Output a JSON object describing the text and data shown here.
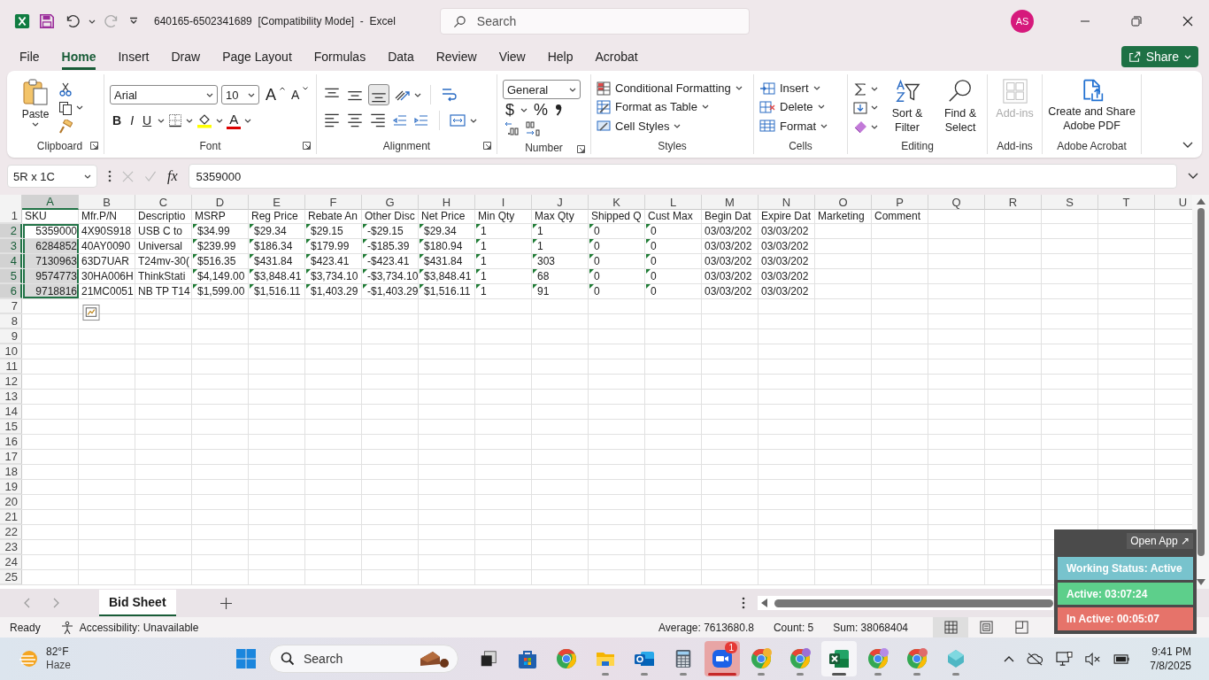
{
  "title_bar": {
    "title": "640165-6502341689  [Compatibility Mode]  -  Excel",
    "search": {
      "placeholder": "Search"
    },
    "avatar": "AS"
  },
  "menu": {
    "tabs": [
      {
        "label": "File",
        "selected": false
      },
      {
        "label": "Home",
        "selected": true
      },
      {
        "label": "Insert",
        "selected": false
      },
      {
        "label": "Draw",
        "selected": false
      },
      {
        "label": "Page Layout",
        "selected": false
      },
      {
        "label": "Formulas",
        "selected": false
      },
      {
        "label": "Data",
        "selected": false
      },
      {
        "label": "Review",
        "selected": false
      },
      {
        "label": "View",
        "selected": false
      },
      {
        "label": "Help",
        "selected": false
      },
      {
        "label": "Acrobat",
        "selected": false
      }
    ],
    "share": "Share"
  },
  "ribbon": {
    "clipboard": {
      "label": "Clipboard",
      "paste": "Paste"
    },
    "font": {
      "label": "Font",
      "family": "Arial",
      "size": "10",
      "grow": "A",
      "shrink": "A",
      "bold": "B",
      "italic": "I",
      "underline": "U",
      "color_button": "A"
    },
    "alignment": {
      "label": "Alignment",
      "vertical_align": [
        {
          "kind": "top",
          "selected": false
        },
        {
          "kind": "middle",
          "selected": false
        },
        {
          "kind": "bottom",
          "selected": true
        }
      ]
    },
    "number": {
      "label": "Number",
      "format": "General",
      "currency": "$",
      "percent": "%"
    },
    "styles": {
      "label": "Styles",
      "items": [
        {
          "label": "Conditional Formatting",
          "kind": "conditional"
        },
        {
          "label": "Format as Table",
          "kind": "table"
        },
        {
          "label": "Cell Styles",
          "kind": "styles"
        }
      ]
    },
    "cells": {
      "label": "Cells",
      "items": [
        {
          "label": "Insert",
          "kind": "insert"
        },
        {
          "label": "Delete",
          "kind": "delete"
        },
        {
          "label": "Format",
          "kind": "format"
        }
      ]
    },
    "editing": {
      "label": "Editing",
      "sort": "Sort & Filter",
      "find": "Find & Select"
    },
    "addins": {
      "label": "Add-ins",
      "button": "Add-ins",
      "disabled": true
    },
    "acrobat": {
      "label": "Adobe Acrobat",
      "button": "Create and Share Adobe PDF"
    }
  },
  "formula_bar": {
    "name_box": "5R x 1C",
    "fx": "fx",
    "formula": "5359000"
  },
  "grid": {
    "columns": [
      {
        "label": "A",
        "selected": true
      },
      {
        "label": "B",
        "selected": false
      },
      {
        "label": "C",
        "selected": false
      },
      {
        "label": "D",
        "selected": false
      },
      {
        "label": "E",
        "selected": false
      },
      {
        "label": "F",
        "selected": false
      },
      {
        "label": "G",
        "selected": false
      },
      {
        "label": "H",
        "selected": false
      },
      {
        "label": "I",
        "selected": false
      },
      {
        "label": "J",
        "selected": false
      },
      {
        "label": "K",
        "selected": false
      },
      {
        "label": "L",
        "selected": false
      },
      {
        "label": "M",
        "selected": false
      },
      {
        "label": "N",
        "selected": false
      },
      {
        "label": "O",
        "selected": false
      },
      {
        "label": "P",
        "selected": false
      },
      {
        "label": "Q",
        "selected": false
      },
      {
        "label": "R",
        "selected": false
      },
      {
        "label": "S",
        "selected": false
      },
      {
        "label": "T",
        "selected": false
      },
      {
        "label": "U",
        "selected": false
      }
    ],
    "rows": [
      {
        "number": "1",
        "selected": false,
        "cells": [
          {
            "text": "SKU",
            "kind": "text",
            "flag": false
          },
          {
            "text": "Mfr.P/N",
            "kind": "text",
            "flag": false
          },
          {
            "text": "Descriptio",
            "kind": "text",
            "flag": false
          },
          {
            "text": "MSRP",
            "kind": "text",
            "flag": false
          },
          {
            "text": "Reg Price",
            "kind": "text",
            "flag": false
          },
          {
            "text": "Rebate An",
            "kind": "text",
            "flag": false
          },
          {
            "text": "Other Disc",
            "kind": "text",
            "flag": false
          },
          {
            "text": "Net Price",
            "kind": "text",
            "flag": false
          },
          {
            "text": "Min Qty",
            "kind": "text",
            "flag": false
          },
          {
            "text": "Max Qty",
            "kind": "text",
            "flag": false
          },
          {
            "text": "Shipped Q",
            "kind": "text",
            "flag": false
          },
          {
            "text": "Cust Max",
            "kind": "text",
            "flag": false
          },
          {
            "text": "Begin Dat",
            "kind": "text",
            "flag": false
          },
          {
            "text": "Expire Dat",
            "kind": "text",
            "flag": false
          },
          {
            "text": "Marketing",
            "kind": "text",
            "flag": false
          },
          {
            "text": "Comment",
            "kind": "text",
            "flag": false
          }
        ]
      },
      {
        "number": "2",
        "selected": true,
        "cells": [
          {
            "text": "5359000",
            "kind": "number",
            "flag": false
          },
          {
            "text": "4X90S918",
            "kind": "text",
            "flag": false
          },
          {
            "text": "USB C to",
            "kind": "text",
            "flag": false
          },
          {
            "text": "$34.99",
            "kind": "text",
            "flag": true
          },
          {
            "text": "$29.34",
            "kind": "text",
            "flag": true
          },
          {
            "text": "$29.15",
            "kind": "text",
            "flag": true
          },
          {
            "text": "-$29.15",
            "kind": "text",
            "flag": true
          },
          {
            "text": "$29.34",
            "kind": "text",
            "flag": true
          },
          {
            "text": "1",
            "kind": "text",
            "flag": true
          },
          {
            "text": "1",
            "kind": "text",
            "flag": true
          },
          {
            "text": "0",
            "kind": "text",
            "flag": true
          },
          {
            "text": "0",
            "kind": "text",
            "flag": true
          },
          {
            "text": "03/03/202",
            "kind": "text",
            "flag": false
          },
          {
            "text": "03/03/202",
            "kind": "text",
            "flag": false
          }
        ]
      },
      {
        "number": "3",
        "selected": true,
        "cells": [
          {
            "text": "6284852",
            "kind": "number",
            "flag": false
          },
          {
            "text": "40AY0090",
            "kind": "text",
            "flag": false
          },
          {
            "text": "Universal",
            "kind": "text",
            "flag": false
          },
          {
            "text": "$239.99",
            "kind": "text",
            "flag": true
          },
          {
            "text": "$186.34",
            "kind": "text",
            "flag": true
          },
          {
            "text": "$179.99",
            "kind": "text",
            "flag": true
          },
          {
            "text": "-$185.39",
            "kind": "text",
            "flag": true
          },
          {
            "text": "$180.94",
            "kind": "text",
            "flag": true
          },
          {
            "text": "1",
            "kind": "text",
            "flag": true
          },
          {
            "text": "1",
            "kind": "text",
            "flag": true
          },
          {
            "text": "0",
            "kind": "text",
            "flag": true
          },
          {
            "text": "0",
            "kind": "text",
            "flag": true
          },
          {
            "text": "03/03/202",
            "kind": "text",
            "flag": false
          },
          {
            "text": "03/03/202",
            "kind": "text",
            "flag": false
          }
        ]
      },
      {
        "number": "4",
        "selected": true,
        "cells": [
          {
            "text": "7130963",
            "kind": "number",
            "flag": false
          },
          {
            "text": "63D7UAR",
            "kind": "text",
            "flag": false
          },
          {
            "text": "T24mv-30(",
            "kind": "text",
            "flag": false
          },
          {
            "text": "$516.35",
            "kind": "text",
            "flag": true
          },
          {
            "text": "$431.84",
            "kind": "text",
            "flag": true
          },
          {
            "text": "$423.41",
            "kind": "text",
            "flag": true
          },
          {
            "text": "-$423.41",
            "kind": "text",
            "flag": true
          },
          {
            "text": "$431.84",
            "kind": "text",
            "flag": true
          },
          {
            "text": "1",
            "kind": "text",
            "flag": true
          },
          {
            "text": "303",
            "kind": "text",
            "flag": true
          },
          {
            "text": "0",
            "kind": "text",
            "flag": true
          },
          {
            "text": "0",
            "kind": "text",
            "flag": true
          },
          {
            "text": "03/03/202",
            "kind": "text",
            "flag": false
          },
          {
            "text": "03/03/202",
            "kind": "text",
            "flag": false
          }
        ]
      },
      {
        "number": "5",
        "selected": true,
        "cells": [
          {
            "text": "9574773",
            "kind": "number",
            "flag": false
          },
          {
            "text": "30HA006H",
            "kind": "text",
            "flag": false
          },
          {
            "text": "ThinkStati",
            "kind": "text",
            "flag": false
          },
          {
            "text": "$4,149.00",
            "kind": "text",
            "flag": true
          },
          {
            "text": "$3,848.41",
            "kind": "text",
            "flag": true
          },
          {
            "text": "$3,734.10",
            "kind": "text",
            "flag": true
          },
          {
            "text": "-$3,734.10",
            "kind": "text",
            "flag": true
          },
          {
            "text": "$3,848.41",
            "kind": "text",
            "flag": true
          },
          {
            "text": "1",
            "kind": "text",
            "flag": true
          },
          {
            "text": "68",
            "kind": "text",
            "flag": true
          },
          {
            "text": "0",
            "kind": "text",
            "flag": true
          },
          {
            "text": "0",
            "kind": "text",
            "flag": true
          },
          {
            "text": "03/03/202",
            "kind": "text",
            "flag": false
          },
          {
            "text": "03/03/202",
            "kind": "text",
            "flag": false
          }
        ]
      },
      {
        "number": "6",
        "selected": true,
        "cells": [
          {
            "text": "9718816",
            "kind": "number",
            "flag": false
          },
          {
            "text": "21MC0051",
            "kind": "text",
            "flag": false
          },
          {
            "text": "NB TP T14",
            "kind": "text",
            "flag": false
          },
          {
            "text": "$1,599.00",
            "kind": "text",
            "flag": true
          },
          {
            "text": "$1,516.11",
            "kind": "text",
            "flag": true
          },
          {
            "text": "$1,403.29",
            "kind": "text",
            "flag": true
          },
          {
            "text": "-$1,403.29",
            "kind": "text",
            "flag": true
          },
          {
            "text": "$1,516.11",
            "kind": "text",
            "flag": true
          },
          {
            "text": "1",
            "kind": "text",
            "flag": true
          },
          {
            "text": "91",
            "kind": "text",
            "flag": true
          },
          {
            "text": "0",
            "kind": "text",
            "flag": true
          },
          {
            "text": "0",
            "kind": "text",
            "flag": true
          },
          {
            "text": "03/03/202",
            "kind": "text",
            "flag": false
          },
          {
            "text": "03/03/202",
            "kind": "text",
            "flag": false
          }
        ]
      },
      {
        "number": "7",
        "selected": false
      },
      {
        "number": "8",
        "selected": false
      },
      {
        "number": "9",
        "selected": false
      },
      {
        "number": "10",
        "selected": false
      },
      {
        "number": "11",
        "selected": false
      },
      {
        "number": "12",
        "selected": false
      },
      {
        "number": "13",
        "selected": false
      },
      {
        "number": "14",
        "selected": false
      },
      {
        "number": "15",
        "selected": false
      },
      {
        "number": "16",
        "selected": false
      },
      {
        "number": "17",
        "selected": false
      },
      {
        "number": "18",
        "selected": false
      },
      {
        "number": "19",
        "selected": false
      },
      {
        "number": "20",
        "selected": false
      },
      {
        "number": "21",
        "selected": false
      },
      {
        "number": "22",
        "selected": false
      },
      {
        "number": "23",
        "selected": false
      },
      {
        "number": "24",
        "selected": false
      },
      {
        "number": "25",
        "selected": false
      }
    ]
  },
  "sheet_tabs": {
    "tabs": [
      {
        "label": "Bid Sheet",
        "selected": true
      }
    ]
  },
  "status_bar": {
    "mode": "Ready",
    "accessibility": "Accessibility: Unavailable",
    "average": "Average: 7613680.8",
    "count": "Count: 5",
    "sum": "Sum: 38068404",
    "views": [
      {
        "kind": "normal",
        "selected": true
      },
      {
        "kind": "page_layout",
        "selected": false
      },
      {
        "kind": "page_break",
        "selected": false
      }
    ]
  },
  "tracker": {
    "open_app": "Open App ↗",
    "rows": [
      {
        "text": "Working Status: Active",
        "color": "#78c3cd"
      },
      {
        "text": "Active: 03:07:24",
        "color": "#5dcf8b"
      },
      {
        "text": "In Active: 00:05:07",
        "color": "#e6736a"
      }
    ]
  },
  "taskbar": {
    "weather": {
      "temp": "82°F",
      "condition": "Haze"
    },
    "search": {
      "placeholder": "Search"
    },
    "apps": [
      {
        "kind": "taskview",
        "open": false,
        "selected": false,
        "attention": false
      },
      {
        "kind": "store",
        "open": false,
        "selected": false,
        "attention": false
      },
      {
        "kind": "chrome",
        "open": false,
        "selected": false,
        "attention": false
      },
      {
        "kind": "files",
        "open": true,
        "selected": false,
        "attention": false
      },
      {
        "kind": "outlook",
        "open": true,
        "selected": false,
        "attention": false
      },
      {
        "kind": "calculator",
        "open": true,
        "selected": false,
        "attention": false
      },
      {
        "kind": "zoom",
        "open": true,
        "selected": false,
        "attention": true,
        "badge": "1"
      },
      {
        "kind": "chrome",
        "open": true,
        "selected": false,
        "attention": false,
        "color": "#f2b233"
      },
      {
        "kind": "chrome",
        "open": true,
        "selected": false,
        "attention": false,
        "color": "#9c6fd6"
      },
      {
        "kind": "excel",
        "open": true,
        "selected": true,
        "attention": false
      },
      {
        "kind": "chrome",
        "open": true,
        "selected": false,
        "attention": false,
        "color": "#b58be8"
      },
      {
        "kind": "chrome",
        "open": true,
        "selected": false,
        "attention": false,
        "color": "#e06a6a"
      },
      {
        "kind": "diamond",
        "open": true,
        "selected": false,
        "attention": false
      }
    ],
    "time": "9:41 PM",
    "date": "7/8/2025"
  }
}
